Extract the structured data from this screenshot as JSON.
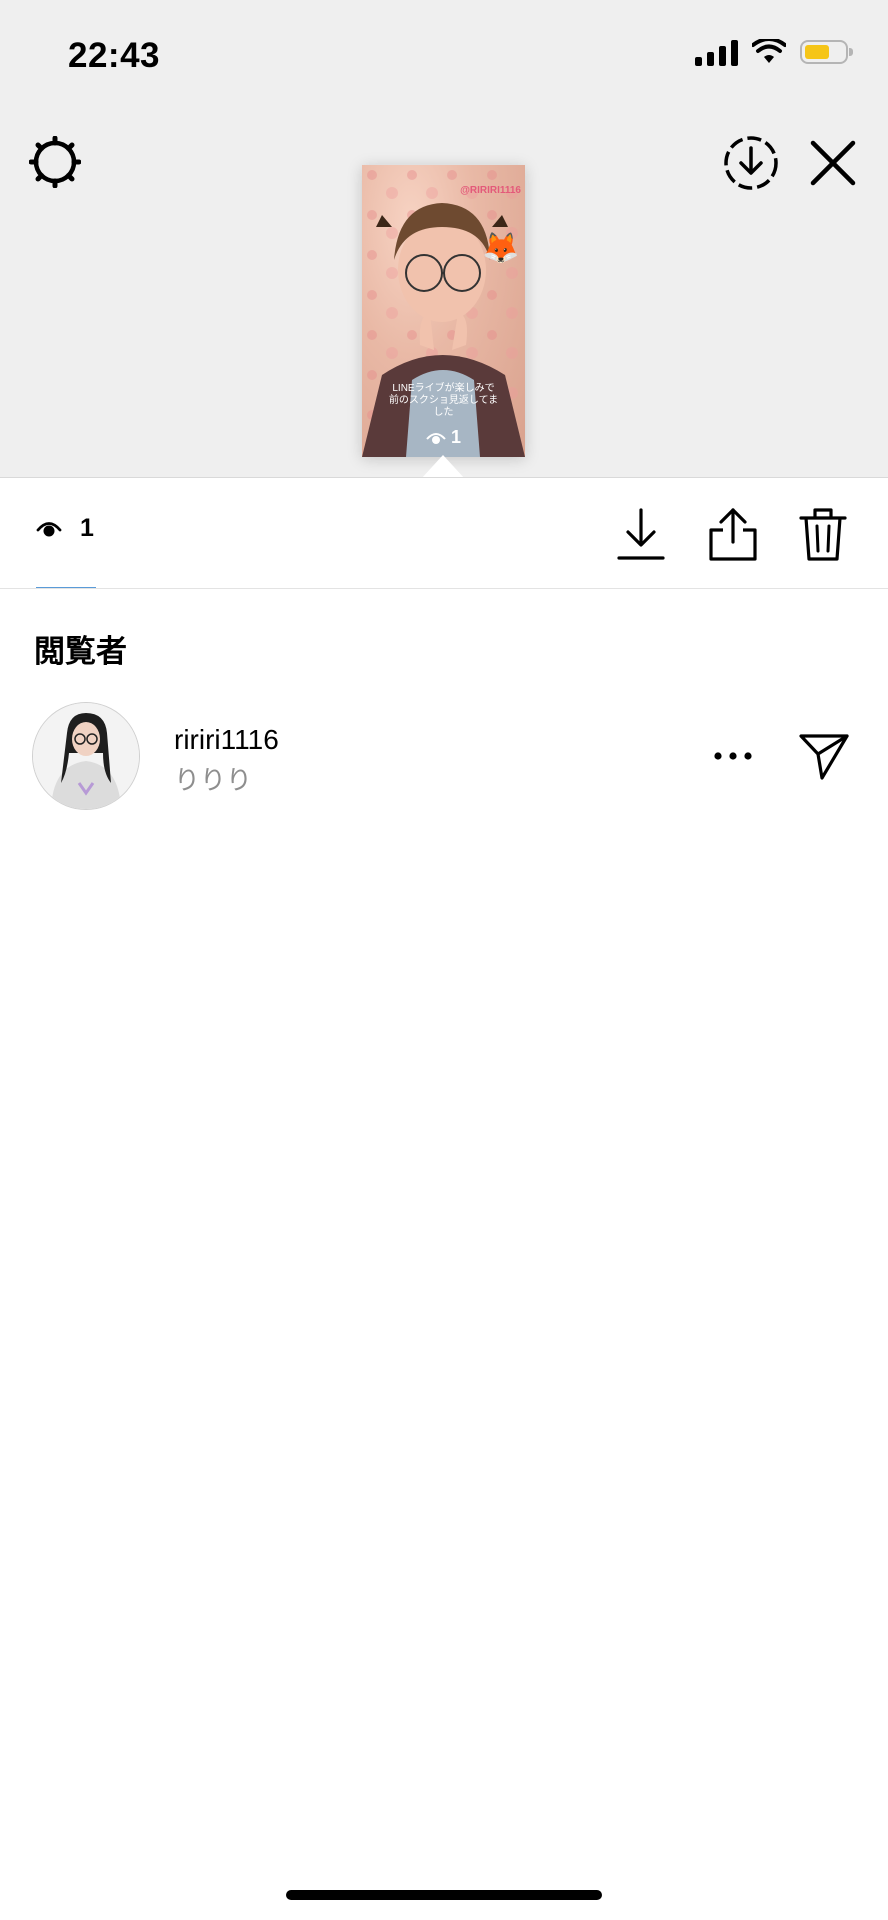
{
  "status_bar": {
    "time": "22:43",
    "battery_color": "#f5c518"
  },
  "header": {
    "settings_icon": "gear-icon",
    "save_icon": "download-circle-icon",
    "close_icon": "close-icon"
  },
  "story_thumbnail": {
    "handle": "@RIRIRI1116",
    "caption_line1": "LINEライブが楽しみで",
    "caption_line2": "前のスクショ見返してま",
    "caption_line3": "した",
    "sticker": "🦊",
    "view_count": "1"
  },
  "toolbar": {
    "view_count": "1",
    "actions": [
      "download-icon",
      "share-icon",
      "trash-icon"
    ]
  },
  "viewers": {
    "title": "閲覧者",
    "items": [
      {
        "username": "ririri1116",
        "full_name": "りりり"
      }
    ]
  }
}
